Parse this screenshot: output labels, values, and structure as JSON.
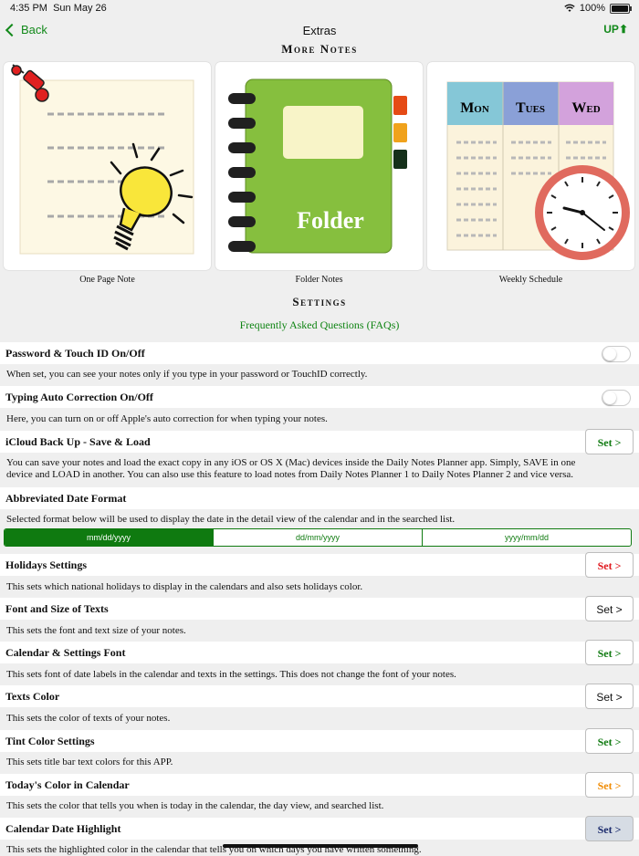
{
  "status": {
    "time": "4:35 PM",
    "date": "Sun May 26",
    "battery": "100%"
  },
  "nav": {
    "back": "Back",
    "title": "Extras",
    "up": "UP"
  },
  "more_notes": {
    "title": "More Notes",
    "cards": [
      {
        "label": "One Page Note"
      },
      {
        "label": "Folder Notes",
        "art_text": "Folder"
      },
      {
        "label": "Weekly Schedule",
        "days": [
          "Mon",
          "Tues",
          "Wed"
        ]
      }
    ]
  },
  "settings": {
    "title": "Settings",
    "faq": "Frequently Asked Questions (FAQs)",
    "password": {
      "title": "Password & Touch ID On/Off",
      "desc": "When set, you can see your notes only if you type in your password or TouchID correctly.",
      "on": false
    },
    "autocorrect": {
      "title": "Typing Auto Correction On/Off",
      "desc": "Here, you can turn on or off Apple's auto correction for when typing your notes.",
      "on": false
    },
    "icloud": {
      "title": "iCloud Back Up - Save & Load",
      "button": "Set >",
      "button_color": "#0f7a10",
      "desc_1": "You can save your notes and load the exact copy in any iOS or OS X (Mac) devices inside the Daily Notes Planner app. Simply, SAVE in one",
      "desc_2": "device and LOAD in another. You can also use this feature to load notes from Daily Notes Planner 1 to Daily Notes Planner 2 and vice versa."
    },
    "date_format": {
      "title": "Abbreviated Date Format",
      "desc": "Selected format below will be used to display the date in the detail view of the calendar and in the searched list.",
      "options": [
        "mm/dd/yyyy",
        "dd/mm/yyyy",
        "yyyy/mm/dd"
      ],
      "selected": "mm/dd/yyyy"
    },
    "holidays": {
      "title": "Holidays Settings",
      "button": "Set >",
      "button_color": "#e0151b",
      "desc": "This sets which national holidays to display in the calendars and also sets holidays color."
    },
    "font": {
      "title": "Font and Size of Texts",
      "button": "Set >",
      "button_color": "#111111",
      "desc": "This sets the font and text size of your notes."
    },
    "calendar_font": {
      "title": "Calendar & Settings Font",
      "button": "Set >",
      "button_color": "#0f7a10",
      "desc": "This sets font of date labels in the calendar and texts in the settings. This does not change the font of your notes."
    },
    "texts_color": {
      "title": "Texts Color",
      "button": "Set >",
      "button_color": "#111111",
      "desc": "This sets the color of texts of your notes."
    },
    "tint": {
      "title": "Tint Color Settings",
      "button": "Set >",
      "button_color": "#0f7a10",
      "desc": "This sets title bar text colors for this APP."
    },
    "today_color": {
      "title": "Today's Color in Calendar",
      "button": "Set >",
      "button_color": "#f08a00",
      "desc": "This sets the color that tells you when is today in the calendar, the day view, and searched list."
    },
    "date_highlight": {
      "title": "Calendar Date Highlight",
      "button": "Set >",
      "button_color": "#1a2a6c",
      "desc": "This sets the highlighted color in the calendar that tells you on which days you have written something."
    }
  }
}
